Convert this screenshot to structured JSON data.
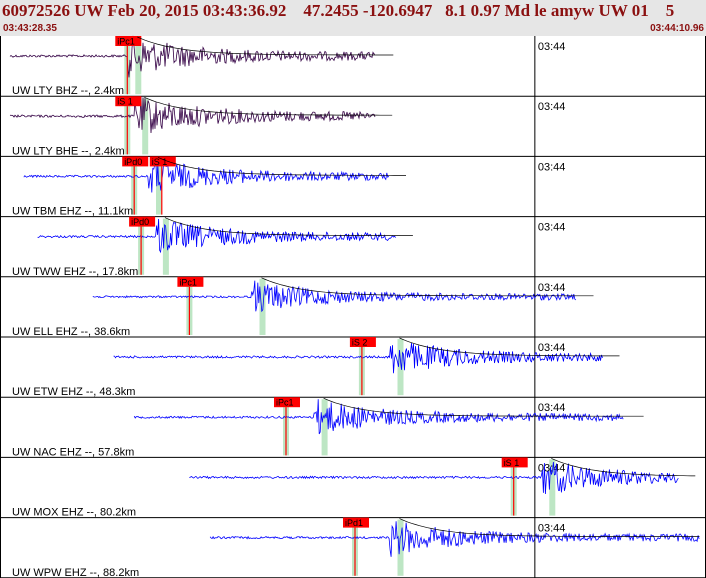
{
  "header": {
    "title": "60972526 UW Feb 20, 2015 03:43:36.92    47.2455 -120.6947   8.1 0.97 Md le amyw UW 01    5",
    "start_time": "03:43:28.35",
    "end_time": "03:44:10.96"
  },
  "minute_mark": "03:44",
  "colors": {
    "header_bg": "#e6e6e6",
    "header_text": "#8b1010",
    "trace_dark": "#330044",
    "trace_blue": "#0000ff",
    "pick_red": "#ff0000",
    "window_green": "#bde6c4",
    "separator": "#000000"
  },
  "channels": [
    {
      "label": "UW LTY BHZ --, 2.4km",
      "color": "dark",
      "start": 0.0,
      "end": 0.53,
      "onset": 0.17,
      "amp": 1.0,
      "picks": [
        {
          "label": "iPc1",
          "t": 0.17
        }
      ]
    },
    {
      "label": "UW LTY BHE --, 2.4km",
      "color": "dark",
      "start": 0.0,
      "end": 0.53,
      "onset": 0.18,
      "amp": 1.0,
      "picks": [
        {
          "label": "iS 1",
          "t": 0.17
        }
      ]
    },
    {
      "label": "UW TBM EHZ --, 11.1km",
      "color": "blue",
      "start": 0.02,
      "end": 0.55,
      "onset": 0.2,
      "amp": 0.9,
      "picks": [
        {
          "label": "iPd0",
          "t": 0.18
        },
        {
          "label": "iS 1",
          "t": 0.22
        }
      ]
    },
    {
      "label": "UW TWW EHZ --, 17.8km",
      "color": "blue",
      "start": 0.04,
      "end": 0.56,
      "onset": 0.21,
      "amp": 0.9,
      "picks": [
        {
          "label": "iPd0",
          "t": 0.19
        }
      ]
    },
    {
      "label": "UW ELL EHZ --, 38.6km",
      "color": "blue",
      "start": 0.12,
      "end": 0.82,
      "onset": 0.35,
      "amp": 0.8,
      "picks": [
        {
          "label": "iPc1",
          "t": 0.26
        }
      ]
    },
    {
      "label": "UW ETW EHZ --, 48.3km",
      "color": "blue",
      "start": 0.15,
      "end": 0.86,
      "onset": 0.55,
      "amp": 0.9,
      "picks": [
        {
          "label": "iS 2",
          "t": 0.51
        }
      ]
    },
    {
      "label": "UW NAC EHZ --, 57.8km",
      "color": "blue",
      "start": 0.18,
      "end": 0.89,
      "onset": 0.44,
      "amp": 0.9,
      "picks": [
        {
          "label": "iPc1",
          "t": 0.4
        }
      ]
    },
    {
      "label": "UW MOX EHZ --, 80.2km",
      "color": "blue",
      "start": 0.26,
      "end": 0.97,
      "onset": 0.77,
      "amp": 0.9,
      "picks": [
        {
          "label": "iS 1",
          "t": 0.73
        }
      ]
    },
    {
      "label": "UW WPW EHZ --, 88.2km",
      "color": "blue",
      "start": 0.29,
      "end": 1.0,
      "onset": 0.55,
      "amp": 0.9,
      "picks": [
        {
          "label": "iPd1",
          "t": 0.5
        }
      ]
    }
  ]
}
